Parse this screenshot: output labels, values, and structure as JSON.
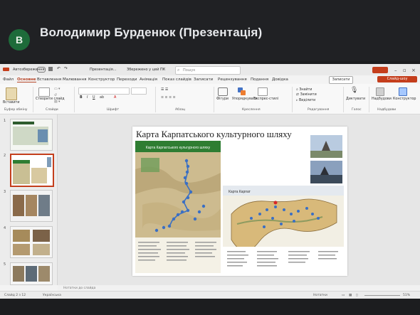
{
  "meet": {
    "avatar_letter": "В",
    "presenter_title": "Володимир Бурденюк (Презентація)"
  },
  "window": {
    "autosave": "Автозбереження",
    "file_name": "Презентація...",
    "saved_state": "Збережено у цей ПК",
    "search_placeholder": "Пошук",
    "share_label": "Спільний доступ",
    "record_label": "Записати",
    "present_label": "Слайд-шоу"
  },
  "tabs": [
    {
      "label": "Файл"
    },
    {
      "label": "Основне"
    },
    {
      "label": "Вставлення"
    },
    {
      "label": "Малювання"
    },
    {
      "label": "Конструктор"
    },
    {
      "label": "Переходи"
    },
    {
      "label": "Анімація"
    },
    {
      "label": "Показ слайдів"
    },
    {
      "label": "Записати"
    },
    {
      "label": "Рецензування"
    },
    {
      "label": "Подання"
    },
    {
      "label": "Довідка"
    }
  ],
  "ribbon": {
    "groups": [
      "Буфер обміну",
      "Слайди",
      "Шрифт",
      "Абзац",
      "Креслення",
      "Редагування",
      "Голос",
      "Надбудови"
    ],
    "items": {
      "paste": "Вставити",
      "new_slide": "Створити слайд",
      "shapes": "Фігури",
      "arrange": "Упорядкувати",
      "quick_styles": "Експрес-стилі",
      "find": "Знайти",
      "replace": "Замінити",
      "select": "Виділити",
      "dictate": "Диктувати",
      "addins": "Надбудови",
      "designer": "Конструктор"
    }
  },
  "thumbnails": [
    {
      "num": "1"
    },
    {
      "num": "2"
    },
    {
      "num": "3"
    },
    {
      "num": "4"
    },
    {
      "num": "5"
    }
  ],
  "slide": {
    "title": "Карта Карпатського культурного шляху",
    "left_map_header": "Карта Карпатського культурного шляху",
    "right_map_header": "Карта Карпат"
  },
  "notes_placeholder": "Нотатки до слайда",
  "status": {
    "slide_counter": "Слайд 2 з 12",
    "language": "Українська",
    "notes_btn": "Нотатки",
    "zoom": "51%"
  },
  "colors": {
    "accent": "#c43e1c",
    "meet_background": "#202124",
    "avatar": "#1e6b3a",
    "map_green": "#2e7d32",
    "map_terrain": "#d8c9a0",
    "route_blue": "#3a6fc4"
  }
}
